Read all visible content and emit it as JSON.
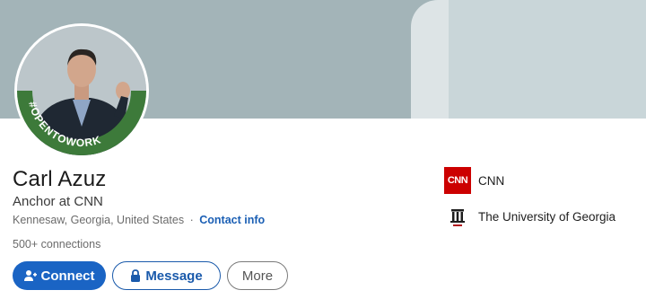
{
  "profile": {
    "name": "Carl Azuz",
    "headline": "Anchor at CNN",
    "location": "Kennesaw, Georgia, United States",
    "location_separator": "·",
    "contact_info_label": "Contact info",
    "connections": "500+ connections",
    "open_to_work_badge": "#OPENTOWORK"
  },
  "actions": {
    "connect_label": "Connect",
    "message_label": "Message",
    "more_label": "More"
  },
  "organizations": [
    {
      "name": "CNN",
      "logo_text": "CNN",
      "logo_icon": "cnn-logo"
    },
    {
      "name": "The University of Georgia",
      "logo_icon": "uga-arch-logo"
    }
  ],
  "colors": {
    "primary_button": "#1a64c4",
    "link": "#1b5fb4",
    "open_to_work_ring": "#3d7a3a",
    "banner": "#a3b4b8",
    "cnn_red": "#cc0000"
  }
}
